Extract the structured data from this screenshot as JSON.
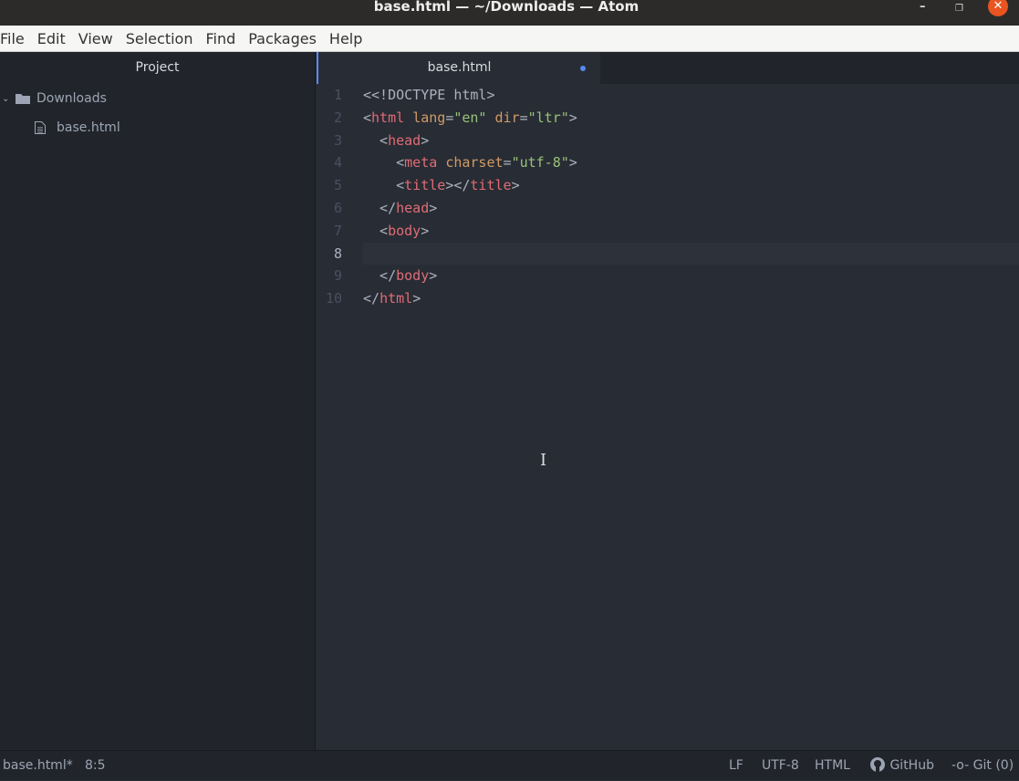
{
  "window": {
    "title": "base.html — ~/Downloads — Atom",
    "minimize": "–",
    "restore": "❐",
    "close": "✕"
  },
  "menu": [
    "File",
    "Edit",
    "View",
    "Selection",
    "Find",
    "Packages",
    "Help"
  ],
  "sidebar": {
    "title": "Project",
    "folder": "Downloads",
    "file": "base.html"
  },
  "tab": {
    "label": "base.html",
    "modified": true
  },
  "editor": {
    "current_line": 8,
    "lines": [
      [
        [
          "p",
          "<<!DOCTYPE html>"
        ]
      ],
      [
        [
          "p",
          "<"
        ],
        [
          "t",
          "html"
        ],
        [
          "p",
          " "
        ],
        [
          "a",
          "lang"
        ],
        [
          "p",
          "="
        ],
        [
          "s",
          "\"en\""
        ],
        [
          "p",
          " "
        ],
        [
          "a",
          "dir"
        ],
        [
          "p",
          "="
        ],
        [
          "s",
          "\"ltr\""
        ],
        [
          "p",
          ">"
        ]
      ],
      [
        [
          "p",
          "  <"
        ],
        [
          "t",
          "head"
        ],
        [
          "p",
          ">"
        ]
      ],
      [
        [
          "p",
          "    <"
        ],
        [
          "t",
          "meta"
        ],
        [
          "p",
          " "
        ],
        [
          "a",
          "charset"
        ],
        [
          "p",
          "="
        ],
        [
          "s",
          "\"utf-8\""
        ],
        [
          "p",
          ">"
        ]
      ],
      [
        [
          "p",
          "    <"
        ],
        [
          "t",
          "title"
        ],
        [
          "p",
          "></"
        ],
        [
          "t",
          "title"
        ],
        [
          "p",
          ">"
        ]
      ],
      [
        [
          "p",
          "  </"
        ],
        [
          "t",
          "head"
        ],
        [
          "p",
          ">"
        ]
      ],
      [
        [
          "p",
          "  <"
        ],
        [
          "t",
          "body"
        ],
        [
          "p",
          ">"
        ]
      ],
      [],
      [
        [
          "p",
          "  </"
        ],
        [
          "t",
          "body"
        ],
        [
          "p",
          ">"
        ]
      ],
      [
        [
          "p",
          "</"
        ],
        [
          "t",
          "html"
        ],
        [
          "p",
          ">"
        ]
      ]
    ]
  },
  "status": {
    "file": "base.html*",
    "position": "8:5",
    "line_ending": "LF",
    "encoding": "UTF-8",
    "grammar": "HTML",
    "github": "GitHub",
    "git": "Git (0)"
  },
  "colors": {
    "accent": "#568af2",
    "close": "#e95420",
    "tag": "#e06c75",
    "attr": "#d19a66",
    "string": "#98c379"
  }
}
